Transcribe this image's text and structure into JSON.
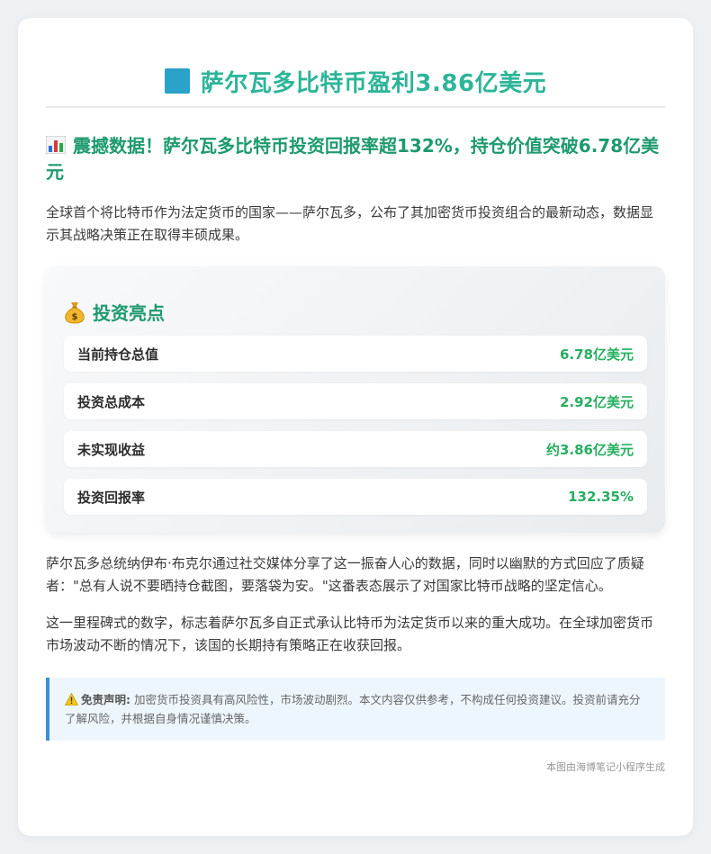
{
  "header": {
    "title": "萨尔瓦多比特币盈利3.86亿美元",
    "square_color": "#2aa2c9",
    "title_color": "#2db598"
  },
  "subtitle": {
    "icon": "bar-chart-icon",
    "text": "震撼数据！萨尔瓦多比特币投资回报率超132%，持仓价值突破6.78亿美元"
  },
  "intro": "全球首个将比特币作为法定货币的国家——萨尔瓦多，公布了其加密货币投资组合的最新动态，数据显示其战略决策正在取得丰硕成果。",
  "highlights": {
    "icon": "money-bag-icon",
    "title": "投资亮点",
    "items": [
      {
        "label": "当前持仓总值",
        "value": "6.78亿美元"
      },
      {
        "label": "投资总成本",
        "value": "2.92亿美元"
      },
      {
        "label": "未实现收益",
        "value": "约3.86亿美元"
      },
      {
        "label": "投资回报率",
        "value": "132.35%"
      }
    ]
  },
  "paragraph1": "萨尔瓦多总统纳伊布·布克尔通过社交媒体分享了这一振奋人心的数据，同时以幽默的方式回应了质疑者：\"总有人说不要晒持仓截图，要落袋为安。\"这番表态展示了对国家比特币战略的坚定信心。",
  "paragraph2": "这一里程碑式的数字，标志着萨尔瓦多自正式承认比特币为法定货币以来的重大成功。在全球加密货币市场波动不断的情况下，该国的长期持有策略正在收获回报。",
  "disclaimer": {
    "icon": "warning-icon",
    "label": "免责声明:",
    "text": "加密货币投资具有高风险性，市场波动剧烈。本文内容仅供参考，不构成任何投资建议。投资前请充分了解风险，并根据自身情况谨慎决策。"
  },
  "footer": "本图由海博笔记小程序生成"
}
